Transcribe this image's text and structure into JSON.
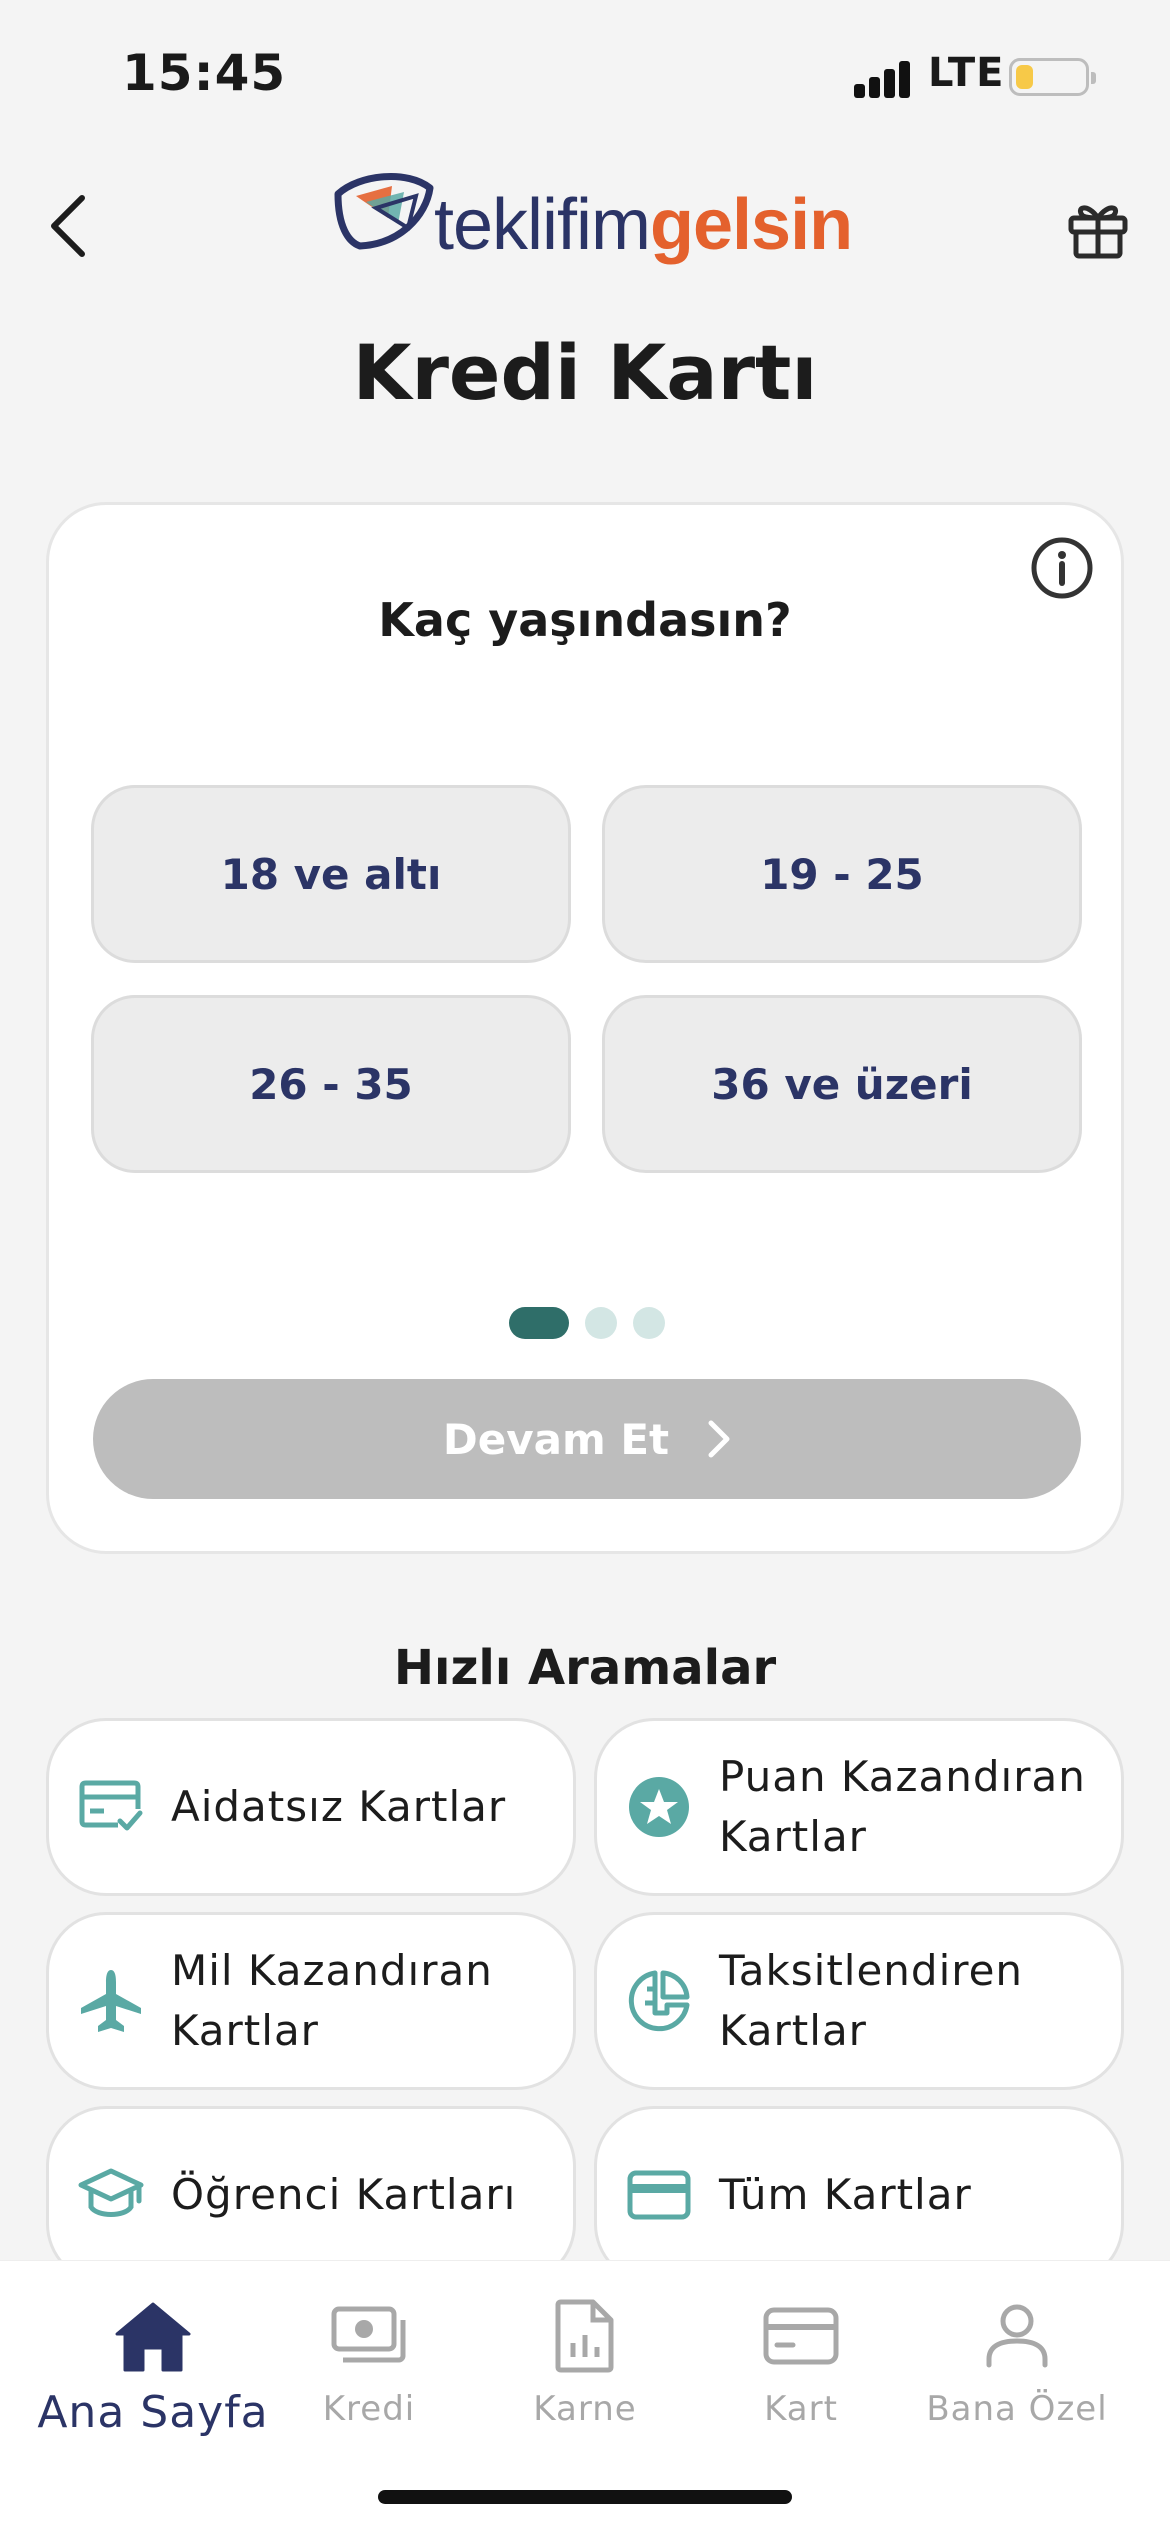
{
  "status_bar": {
    "time": "15:45",
    "network": "LTE",
    "battery_level": 0.25
  },
  "header": {
    "logo_part1": "teklifim",
    "logo_part2": "gelsin",
    "back_icon": "chevron-left-icon",
    "gift_icon": "gift-icon"
  },
  "page_title": "Kredi Kartı",
  "question_card": {
    "question": "Kaç yaşındasın?",
    "info_icon": "info-icon",
    "options": [
      "18 ve altı",
      "19 - 25",
      "26 - 35",
      "36 ve üzeri"
    ],
    "step_current": 1,
    "step_total": 3,
    "continue_label": "Devam Et"
  },
  "quick_search": {
    "title": "Hızlı Aramalar",
    "items": [
      {
        "label": "Aidatsız Kartlar",
        "icon": "card-check-icon"
      },
      {
        "label": "Puan Kazandıran Kartlar",
        "icon": "star-badge-icon"
      },
      {
        "label": "Mil Kazandıran Kartlar",
        "icon": "airplane-icon"
      },
      {
        "label": "Taksitlendiren Kartlar",
        "icon": "installment-icon"
      },
      {
        "label": "Öğrenci Kartları",
        "icon": "graduation-cap-icon"
      },
      {
        "label": "Tüm Kartlar",
        "icon": "credit-card-icon"
      }
    ]
  },
  "tab_bar": {
    "items": [
      {
        "label": "Ana Sayfa",
        "icon": "home-icon",
        "active": true
      },
      {
        "label": "Kredi",
        "icon": "cash-icon",
        "active": false
      },
      {
        "label": "Karne",
        "icon": "report-icon",
        "active": false
      },
      {
        "label": "Kart",
        "icon": "card-icon",
        "active": false
      },
      {
        "label": "Bana Özel",
        "icon": "user-icon",
        "active": false
      }
    ]
  },
  "colors": {
    "navy": "#2b3466",
    "orange": "#e4612d",
    "teal": "#5aa9a4",
    "dot_active": "#2f6e69",
    "dot_inactive": "#d3e6e4",
    "button_disabled": "#bdbdbd"
  }
}
